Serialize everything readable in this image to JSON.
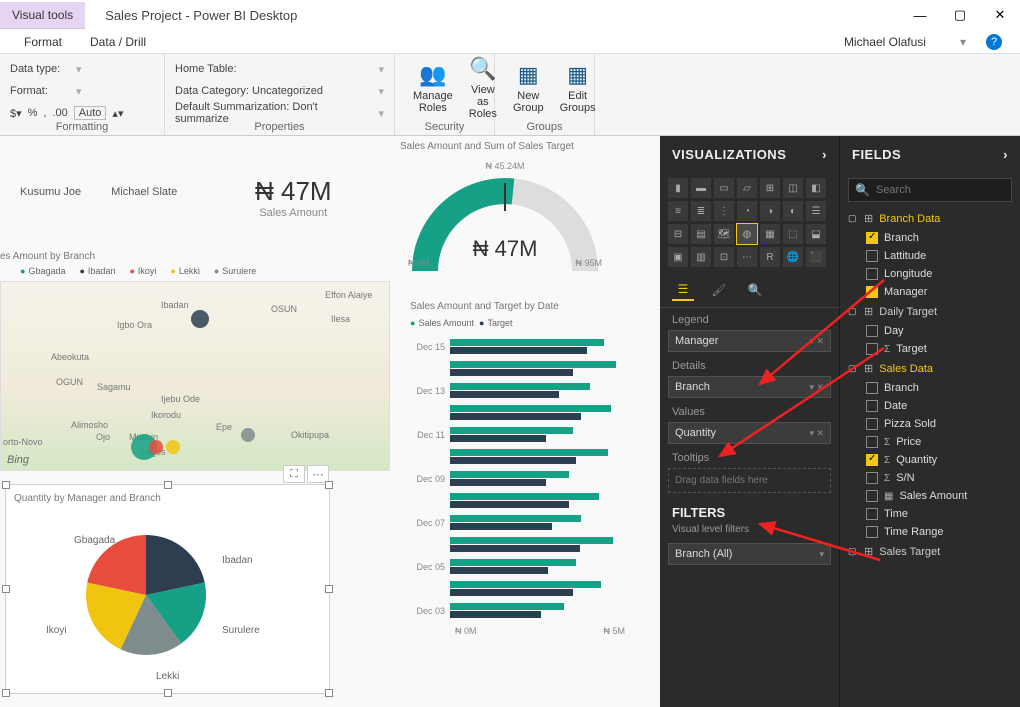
{
  "window": {
    "visual_tools": "Visual tools",
    "title": "Sales Project - Power BI Desktop",
    "user": "Michael Olafusi"
  },
  "menu": {
    "format": "Format",
    "data_drill": "Data / Drill"
  },
  "ribbon": {
    "formatting": {
      "data_type": "Data type:",
      "format_lbl": "Format:",
      "auto": "Auto",
      "group": "Formatting"
    },
    "properties": {
      "home_table": "Home Table:",
      "data_cat": "Data Category: Uncategorized",
      "def_sum": "Default Summarization: Don't summarize",
      "group": "Properties"
    },
    "security": {
      "manage": "Manage\nRoles",
      "view": "View as\nRoles",
      "group": "Security"
    },
    "groups": {
      "new": "New\nGroup",
      "edit": "Edit\nGroups",
      "group": "Groups"
    }
  },
  "kpi": {
    "names": [
      "Kusumu Joe",
      "Michael Slate"
    ],
    "value": "₦ 47M",
    "label": "Sales Amount"
  },
  "gauge": {
    "title": "Sales Amount and Sum of Sales Target",
    "top": "₦ 45.24M",
    "center": "₦ 47M",
    "left": "₦ 0M",
    "right": "₦ 95M"
  },
  "map": {
    "title": "es Amount by Branch",
    "legend": [
      "Gbagada",
      "Ibadan",
      "Ikoyi",
      "Lekki",
      "Surulere"
    ],
    "places": [
      "Ibadan",
      "Alimosho",
      "Lagos",
      "Ojo",
      "Ikorodu",
      "Epe",
      "Okitipupa",
      "Effon Alaiye",
      "OSUN",
      "OGUN",
      "Ilesa",
      "Abeokuta",
      "Igbo Ora",
      "Sagamu",
      "Mushin",
      "orto-Novo",
      "Ijebu Ode"
    ]
  },
  "pie": {
    "title": "Quantity by Manager and Branch",
    "labels": [
      "Gbagada",
      "Ibadan",
      "Surulere",
      "Lekki",
      "Ikoyi"
    ]
  },
  "chart_data": {
    "type": "pie",
    "title": "Quantity by Manager and Branch",
    "series": [
      {
        "name": "Gbagada",
        "value": 22,
        "color": "#2c3e50"
      },
      {
        "name": "Ibadan",
        "value": 20,
        "color": "#16a085"
      },
      {
        "name": "Surulere",
        "value": 18,
        "color": "#7f8c8d"
      },
      {
        "name": "Lekki",
        "value": 20,
        "color": "#f1c40f"
      },
      {
        "name": "Ikoyi",
        "value": 20,
        "color": "#e74c3c"
      }
    ]
  },
  "bar": {
    "title": "Sales Amount and Target by Date",
    "legend": [
      "Sales Amount",
      "Target"
    ],
    "categories": [
      "Dec 15",
      "",
      "Dec 13",
      "",
      "Dec 11",
      "",
      "Dec 09",
      "",
      "Dec 07",
      "",
      "Dec 05",
      "",
      "Dec 03"
    ],
    "axis": [
      "₦ 0M",
      "₦ 5M"
    ],
    "sales": [
      88,
      95,
      80,
      92,
      70,
      90,
      68,
      85,
      75,
      93,
      72,
      86,
      65
    ],
    "target": [
      78,
      70,
      62,
      75,
      55,
      72,
      55,
      68,
      58,
      74,
      56,
      70,
      52
    ]
  },
  "viz": {
    "header": "VISUALIZATIONS",
    "wells": {
      "legend_lbl": "Legend",
      "legend": "Manager",
      "details_lbl": "Details",
      "details": "Branch",
      "values_lbl": "Values",
      "values": "Quantity",
      "tooltips_lbl": "Tooltips",
      "tooltips_ph": "Drag data fields here"
    },
    "filters": {
      "header": "FILTERS",
      "sub": "Visual level filters",
      "item": "Branch (All)"
    }
  },
  "fields": {
    "header": "FIELDS",
    "search_ph": "Search",
    "tables": {
      "branch_data": {
        "label": "Branch Data",
        "fields": [
          {
            "name": "Branch",
            "checked": true
          },
          {
            "name": "Lattitude",
            "checked": false
          },
          {
            "name": "Longitude",
            "checked": false
          },
          {
            "name": "Manager",
            "checked": true
          }
        ]
      },
      "daily_target": {
        "label": "Daily Target",
        "fields": [
          {
            "name": "Day",
            "checked": false
          },
          {
            "name": "Target",
            "checked": false,
            "sigma": true
          }
        ]
      },
      "sales_data": {
        "label": "Sales Data",
        "fields": [
          {
            "name": "Branch",
            "checked": false
          },
          {
            "name": "Date",
            "checked": false
          },
          {
            "name": "Pizza Sold",
            "checked": false
          },
          {
            "name": "Price",
            "checked": false,
            "sigma": true
          },
          {
            "name": "Quantity",
            "checked": true,
            "sigma": true
          },
          {
            "name": "S/N",
            "checked": false,
            "sigma": true
          },
          {
            "name": "Sales Amount",
            "checked": false,
            "calc": true
          },
          {
            "name": "Time",
            "checked": false
          },
          {
            "name": "Time Range",
            "checked": false
          }
        ]
      },
      "sales_target": {
        "label": "Sales Target"
      }
    }
  }
}
